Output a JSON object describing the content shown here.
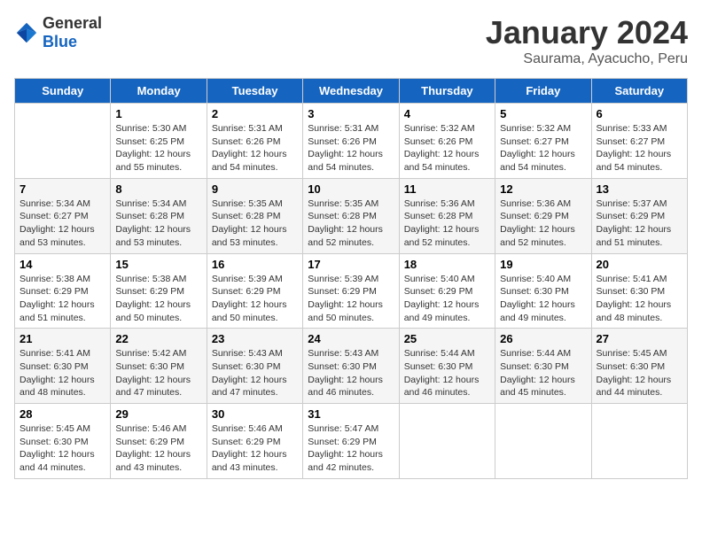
{
  "header": {
    "logo": {
      "general": "General",
      "blue": "Blue"
    },
    "title": "January 2024",
    "subtitle": "Saurama, Ayacucho, Peru"
  },
  "columns": [
    "Sunday",
    "Monday",
    "Tuesday",
    "Wednesday",
    "Thursday",
    "Friday",
    "Saturday"
  ],
  "weeks": [
    [
      {
        "day": "",
        "info": ""
      },
      {
        "day": "1",
        "info": "Sunrise: 5:30 AM\nSunset: 6:25 PM\nDaylight: 12 hours\nand 55 minutes."
      },
      {
        "day": "2",
        "info": "Sunrise: 5:31 AM\nSunset: 6:26 PM\nDaylight: 12 hours\nand 54 minutes."
      },
      {
        "day": "3",
        "info": "Sunrise: 5:31 AM\nSunset: 6:26 PM\nDaylight: 12 hours\nand 54 minutes."
      },
      {
        "day": "4",
        "info": "Sunrise: 5:32 AM\nSunset: 6:26 PM\nDaylight: 12 hours\nand 54 minutes."
      },
      {
        "day": "5",
        "info": "Sunrise: 5:32 AM\nSunset: 6:27 PM\nDaylight: 12 hours\nand 54 minutes."
      },
      {
        "day": "6",
        "info": "Sunrise: 5:33 AM\nSunset: 6:27 PM\nDaylight: 12 hours\nand 54 minutes."
      }
    ],
    [
      {
        "day": "7",
        "info": "Sunrise: 5:34 AM\nSunset: 6:27 PM\nDaylight: 12 hours\nand 53 minutes."
      },
      {
        "day": "8",
        "info": "Sunrise: 5:34 AM\nSunset: 6:28 PM\nDaylight: 12 hours\nand 53 minutes."
      },
      {
        "day": "9",
        "info": "Sunrise: 5:35 AM\nSunset: 6:28 PM\nDaylight: 12 hours\nand 53 minutes."
      },
      {
        "day": "10",
        "info": "Sunrise: 5:35 AM\nSunset: 6:28 PM\nDaylight: 12 hours\nand 52 minutes."
      },
      {
        "day": "11",
        "info": "Sunrise: 5:36 AM\nSunset: 6:28 PM\nDaylight: 12 hours\nand 52 minutes."
      },
      {
        "day": "12",
        "info": "Sunrise: 5:36 AM\nSunset: 6:29 PM\nDaylight: 12 hours\nand 52 minutes."
      },
      {
        "day": "13",
        "info": "Sunrise: 5:37 AM\nSunset: 6:29 PM\nDaylight: 12 hours\nand 51 minutes."
      }
    ],
    [
      {
        "day": "14",
        "info": "Sunrise: 5:38 AM\nSunset: 6:29 PM\nDaylight: 12 hours\nand 51 minutes."
      },
      {
        "day": "15",
        "info": "Sunrise: 5:38 AM\nSunset: 6:29 PM\nDaylight: 12 hours\nand 50 minutes."
      },
      {
        "day": "16",
        "info": "Sunrise: 5:39 AM\nSunset: 6:29 PM\nDaylight: 12 hours\nand 50 minutes."
      },
      {
        "day": "17",
        "info": "Sunrise: 5:39 AM\nSunset: 6:29 PM\nDaylight: 12 hours\nand 50 minutes."
      },
      {
        "day": "18",
        "info": "Sunrise: 5:40 AM\nSunset: 6:29 PM\nDaylight: 12 hours\nand 49 minutes."
      },
      {
        "day": "19",
        "info": "Sunrise: 5:40 AM\nSunset: 6:30 PM\nDaylight: 12 hours\nand 49 minutes."
      },
      {
        "day": "20",
        "info": "Sunrise: 5:41 AM\nSunset: 6:30 PM\nDaylight: 12 hours\nand 48 minutes."
      }
    ],
    [
      {
        "day": "21",
        "info": "Sunrise: 5:41 AM\nSunset: 6:30 PM\nDaylight: 12 hours\nand 48 minutes."
      },
      {
        "day": "22",
        "info": "Sunrise: 5:42 AM\nSunset: 6:30 PM\nDaylight: 12 hours\nand 47 minutes."
      },
      {
        "day": "23",
        "info": "Sunrise: 5:43 AM\nSunset: 6:30 PM\nDaylight: 12 hours\nand 47 minutes."
      },
      {
        "day": "24",
        "info": "Sunrise: 5:43 AM\nSunset: 6:30 PM\nDaylight: 12 hours\nand 46 minutes."
      },
      {
        "day": "25",
        "info": "Sunrise: 5:44 AM\nSunset: 6:30 PM\nDaylight: 12 hours\nand 46 minutes."
      },
      {
        "day": "26",
        "info": "Sunrise: 5:44 AM\nSunset: 6:30 PM\nDaylight: 12 hours\nand 45 minutes."
      },
      {
        "day": "27",
        "info": "Sunrise: 5:45 AM\nSunset: 6:30 PM\nDaylight: 12 hours\nand 44 minutes."
      }
    ],
    [
      {
        "day": "28",
        "info": "Sunrise: 5:45 AM\nSunset: 6:30 PM\nDaylight: 12 hours\nand 44 minutes."
      },
      {
        "day": "29",
        "info": "Sunrise: 5:46 AM\nSunset: 6:29 PM\nDaylight: 12 hours\nand 43 minutes."
      },
      {
        "day": "30",
        "info": "Sunrise: 5:46 AM\nSunset: 6:29 PM\nDaylight: 12 hours\nand 43 minutes."
      },
      {
        "day": "31",
        "info": "Sunrise: 5:47 AM\nSunset: 6:29 PM\nDaylight: 12 hours\nand 42 minutes."
      },
      {
        "day": "",
        "info": ""
      },
      {
        "day": "",
        "info": ""
      },
      {
        "day": "",
        "info": ""
      }
    ]
  ]
}
